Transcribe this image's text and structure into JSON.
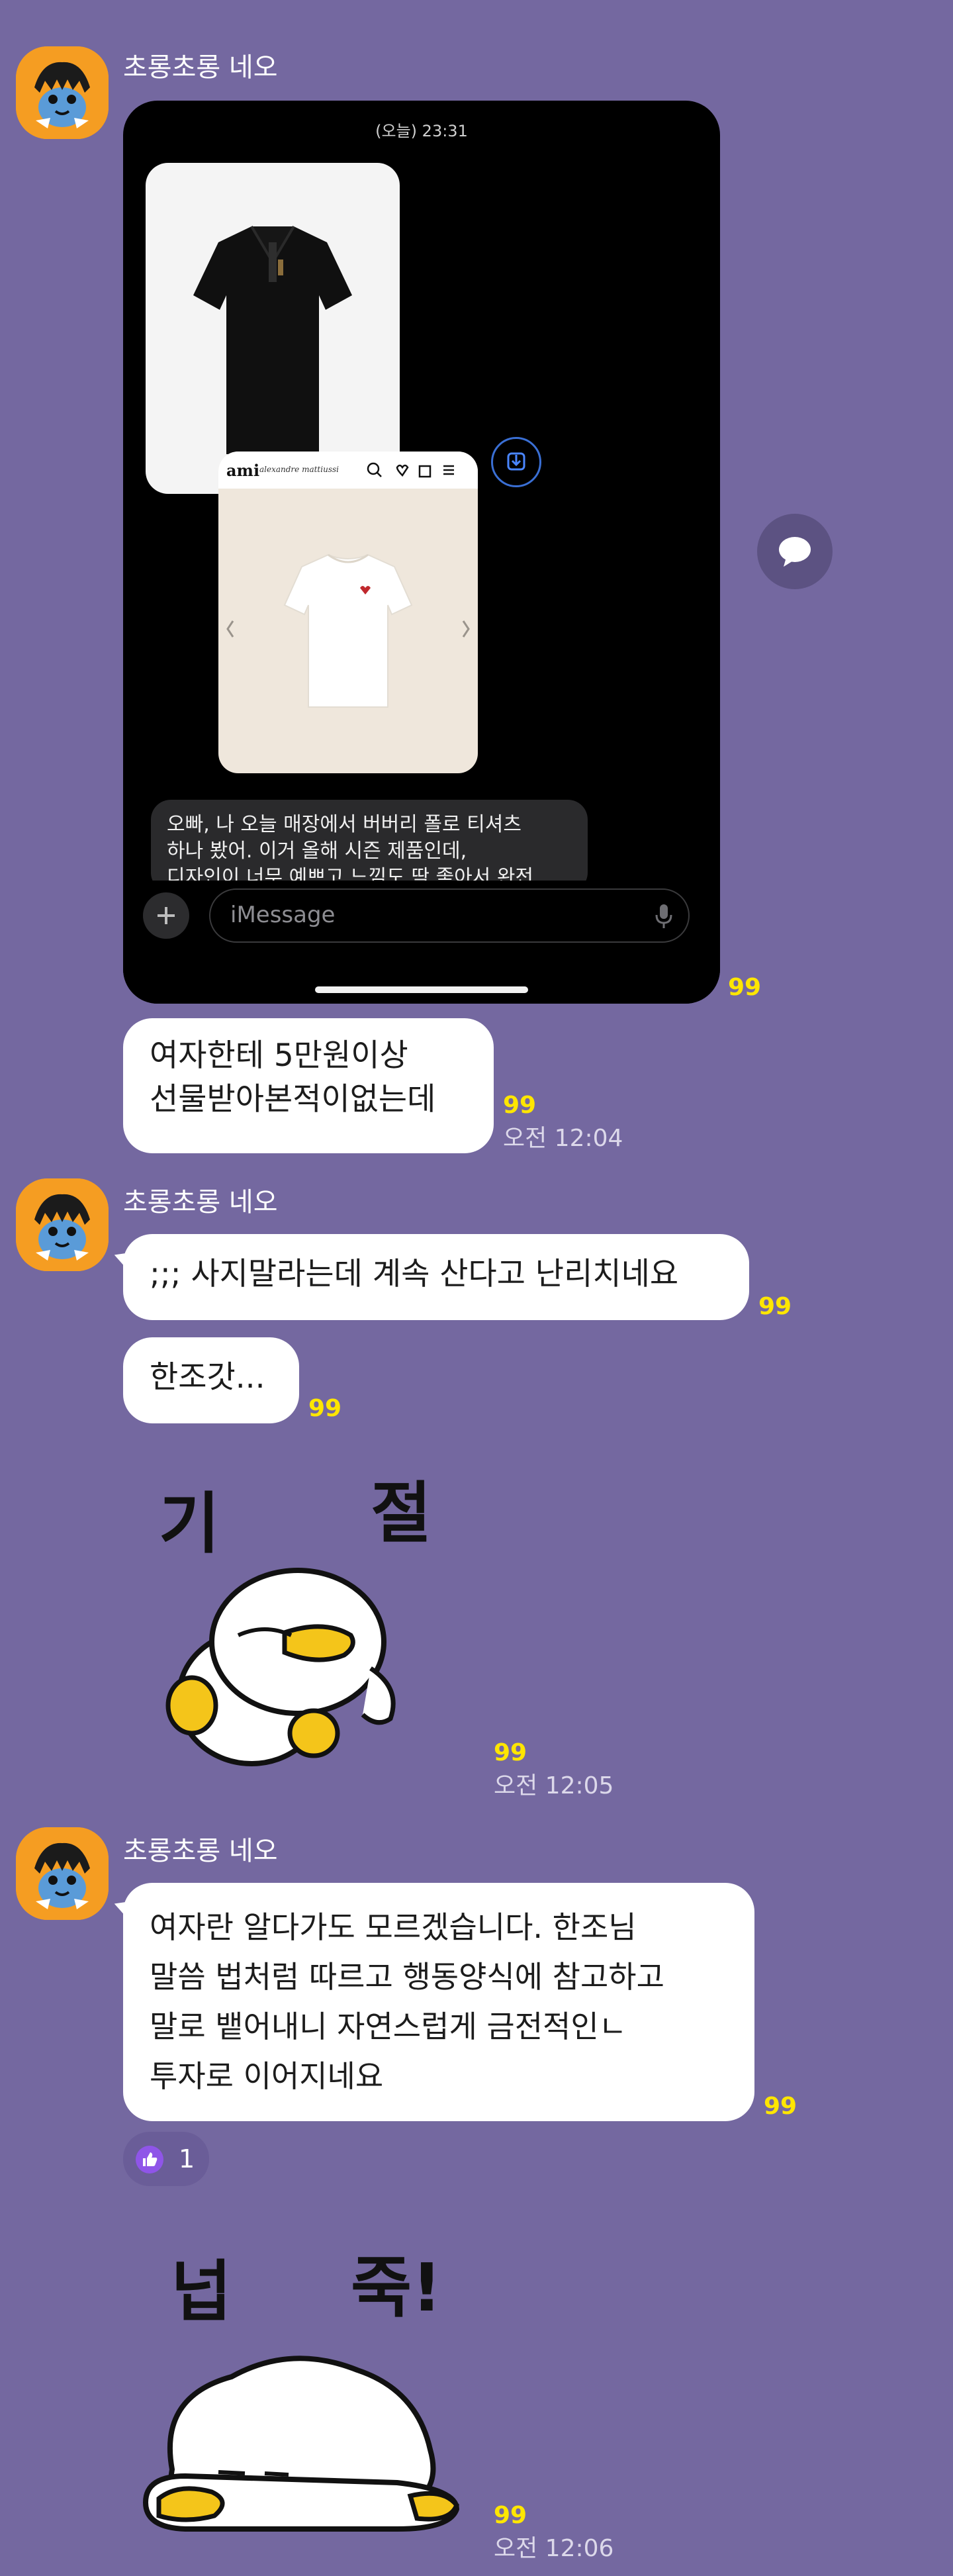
{
  "messages": {
    "sender_name": "초롱초롱 네오",
    "unread_marker": "99",
    "image_message": {
      "phone_time": "(오늘) 23:31",
      "brand_label": "ami",
      "brand_sublabel": "alexandre mattiussi",
      "imessage_preview": "오빠, 나 오늘 매장에서 버버리 폴로 티셔츠 하나 봤어. 이거 올해 시즌 제품인데, 디자인이 너무 예쁘고 느낌도 딱 좋아서 완전",
      "preview_line1": "오빠, 나 오늘 매장에서 버버리 폴로 티셔츠",
      "preview_line2": "하나 봤어. 이거 올해 시즌 제품인데,",
      "preview_line3": "디자인이 너무 예쁘고 느낌도 딱 좋아서 완전",
      "imessage_placeholder": "iMessage"
    },
    "msg1_line1": "여자한테 5만원이상",
    "msg1_line2": "선물받아본적이없는데",
    "time1": "오전 12:04",
    "msg2": ";;; 사지말라는데 계속 산다고 난리치네요",
    "msg3": "한조갓...",
    "sticker1_text_left": "기",
    "sticker1_text_right": "절",
    "time2": "오전 12:05",
    "msg4_line1": "여자란 알다가도 모르겠습니다. 한조님",
    "msg4_line2": "말씀 법처럼 따르고 행동양식에 참고하고",
    "msg4_line3": "말로 뱉어내니 자연스럽게 금전적인ㄴ",
    "msg4_line4": "투자로 이어지네요",
    "reaction_count": "1",
    "sticker2_text_left": "넙",
    "sticker2_text_right": "죽!",
    "time3": "오전 12:06"
  },
  "colors": {
    "background": "#7468a0",
    "bubble": "#ffffff",
    "unread": "#ffe600",
    "avatar_bg": "#f59d22"
  },
  "icons": [
    "neo-avatar-icon",
    "share-speech-icon",
    "plus-icon",
    "mic-icon",
    "like-thumb-icon",
    "download-icon"
  ]
}
